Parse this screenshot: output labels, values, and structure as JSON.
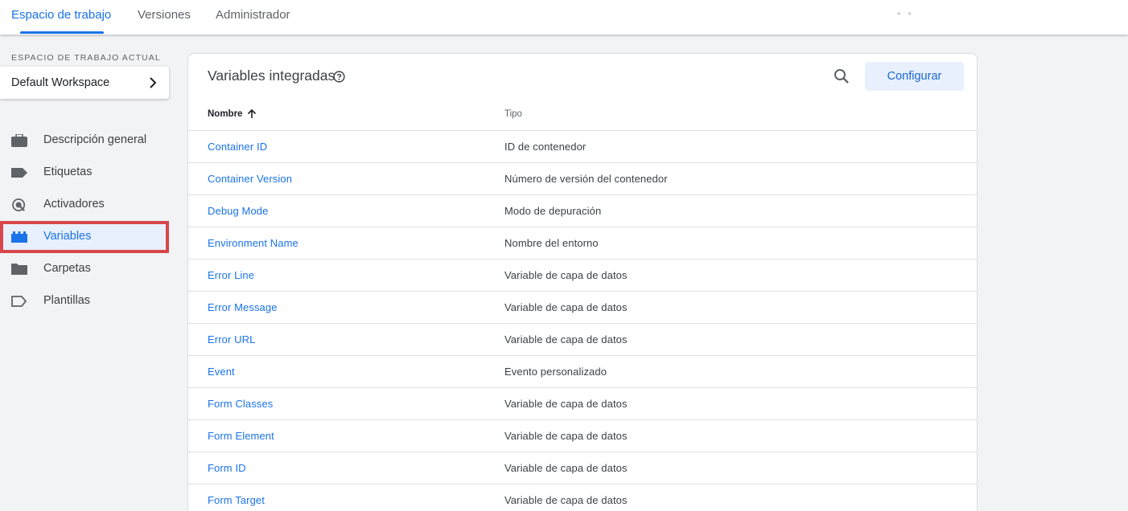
{
  "topnav": {
    "tabs": [
      {
        "label": "Espacio de trabajo"
      },
      {
        "label": "Versiones"
      },
      {
        "label": "Administrador"
      }
    ]
  },
  "sidebar": {
    "workspace_label": "ESPACIO DE TRABAJO ACTUAL",
    "workspace_name": "Default Workspace",
    "items": [
      {
        "label": "Descripción general",
        "icon": "briefcase-icon"
      },
      {
        "label": "Etiquetas",
        "icon": "tag-icon"
      },
      {
        "label": "Activadores",
        "icon": "trigger-icon"
      },
      {
        "label": "Variables",
        "icon": "variables-icon"
      },
      {
        "label": "Carpetas",
        "icon": "folder-icon"
      },
      {
        "label": "Plantillas",
        "icon": "template-icon"
      }
    ]
  },
  "main": {
    "title": "Variables integradas",
    "config_button": "Configurar",
    "columns": {
      "name": "Nombre",
      "type": "Tipo"
    },
    "rows": [
      {
        "name": "Container ID",
        "type": "ID de contenedor"
      },
      {
        "name": "Container Version",
        "type": "Número de versión del contenedor"
      },
      {
        "name": "Debug Mode",
        "type": "Modo de depuración"
      },
      {
        "name": "Environment Name",
        "type": "Nombre del entorno"
      },
      {
        "name": "Error Line",
        "type": "Variable de capa de datos"
      },
      {
        "name": "Error Message",
        "type": "Variable de capa de datos"
      },
      {
        "name": "Error URL",
        "type": "Variable de capa de datos"
      },
      {
        "name": "Event",
        "type": "Evento personalizado"
      },
      {
        "name": "Form Classes",
        "type": "Variable de capa de datos"
      },
      {
        "name": "Form Element",
        "type": "Variable de capa de datos"
      },
      {
        "name": "Form ID",
        "type": "Variable de capa de datos"
      },
      {
        "name": "Form Target",
        "type": "Variable de capa de datos"
      }
    ]
  },
  "colors": {
    "accent": "#1a73e8",
    "highlight_border": "#d8474b",
    "active_bg": "#e8f0fe"
  }
}
